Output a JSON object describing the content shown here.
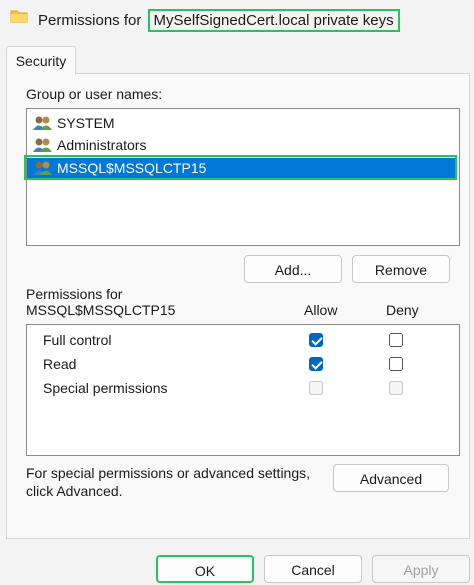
{
  "window": {
    "title_prefix": "Permissions for ",
    "title_object": "MySelfSignedCert.local private keys",
    "icon": "folder-icon"
  },
  "tabs": [
    {
      "label": "Security",
      "active": true
    }
  ],
  "users": {
    "label": "Group or user names:",
    "items": [
      {
        "name": "SYSTEM",
        "icon": "users-icon",
        "selected": false
      },
      {
        "name": "Administrators",
        "icon": "users-icon",
        "selected": false
      },
      {
        "name": "MSSQL$MSSQLCTP15",
        "icon": "users-icon",
        "selected": true
      }
    ],
    "add_label": "Add...",
    "remove_label": "Remove"
  },
  "permissions": {
    "label_line1": "Permissions for",
    "label_line2": "MSSQL$MSSQLCTP15",
    "allow_header": "Allow",
    "deny_header": "Deny",
    "rows": [
      {
        "name": "Full control",
        "allow": true,
        "deny": false,
        "enabled": true
      },
      {
        "name": "Read",
        "allow": true,
        "deny": false,
        "enabled": true
      },
      {
        "name": "Special permissions",
        "allow": false,
        "deny": false,
        "enabled": false
      }
    ]
  },
  "special": {
    "line1": "For special permissions or advanced settings,",
    "line2": "click Advanced.",
    "advanced_label": "Advanced"
  },
  "footer": {
    "ok_label": "OK",
    "cancel_label": "Cancel",
    "apply_label": "Apply"
  },
  "colors": {
    "selection": "#0078d7",
    "highlight_outline": "#22c55e",
    "checkbox": "#0067c0"
  }
}
